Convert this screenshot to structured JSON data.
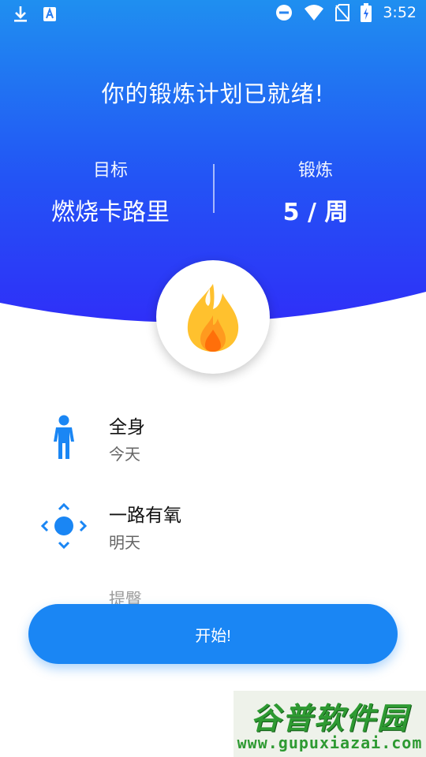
{
  "status_bar": {
    "time": "3:52",
    "icons": [
      "download-icon",
      "app-notification-icon",
      "do-not-disturb-icon",
      "wifi-icon",
      "no-sim-icon",
      "battery-charging-icon"
    ]
  },
  "header": {
    "headline": "你的锻炼计划已就绪!",
    "goal": {
      "label": "目标",
      "value": "燃烧卡路里"
    },
    "workout": {
      "label": "锻炼",
      "value": "5 / 周"
    }
  },
  "badge": {
    "icon": "flame-icon"
  },
  "plan": {
    "items": [
      {
        "title": "全身",
        "subtitle": "今天",
        "icon": "person-icon"
      },
      {
        "title": "一路有氧",
        "subtitle": "明天",
        "icon": "cardio-arrows-icon"
      },
      {
        "title": "提臀",
        "subtitle": "",
        "icon": ""
      }
    ]
  },
  "start_button": {
    "label": "开始!"
  },
  "watermark": {
    "title": "谷普软件园",
    "url": "www.gupuxiazai.com"
  },
  "colors": {
    "accent": "#1a86f4",
    "header_top": "#1f8ff0",
    "header_bottom": "#2f2ff8",
    "flame_outer": "#ffc12e",
    "flame_inner": "#ff7a0f"
  }
}
